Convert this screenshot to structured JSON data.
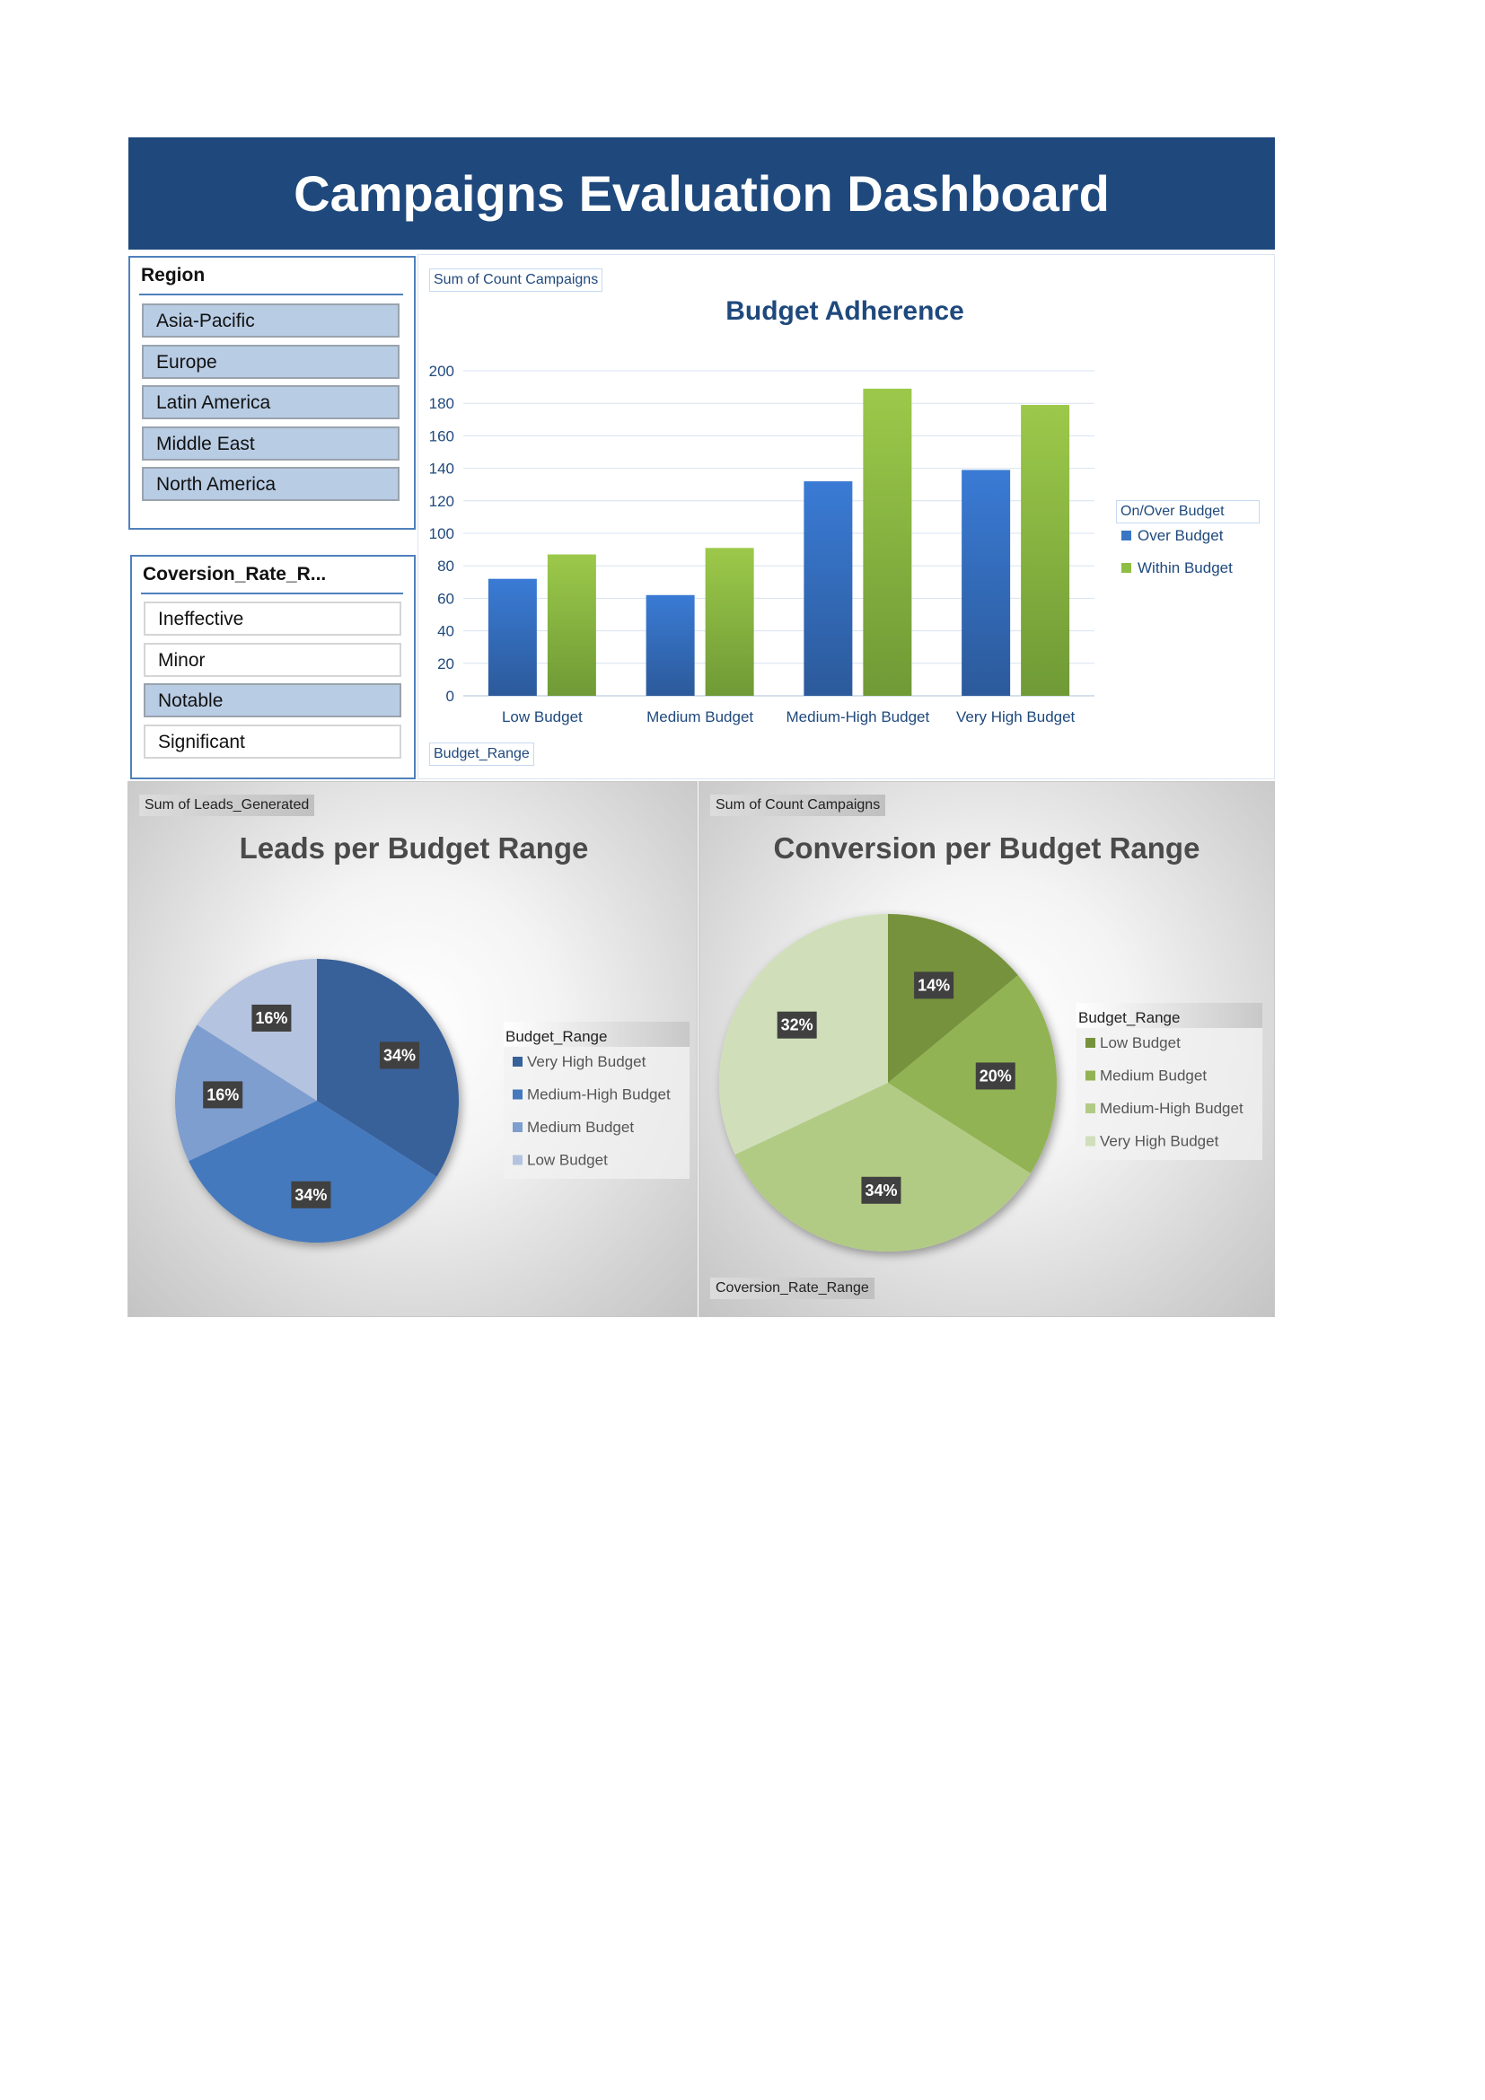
{
  "title": "Campaigns Evaluation Dashboard",
  "region_slicer": {
    "title": "Region",
    "items": [
      {
        "label": "Asia-Pacific",
        "selected": true
      },
      {
        "label": "Europe",
        "selected": true
      },
      {
        "label": "Latin America",
        "selected": true
      },
      {
        "label": "Middle East",
        "selected": true
      },
      {
        "label": "North America",
        "selected": true
      }
    ]
  },
  "conversion_slicer": {
    "title": "Coversion_Rate_R...",
    "items": [
      {
        "label": "Ineffective",
        "selected": false
      },
      {
        "label": "Minor",
        "selected": false
      },
      {
        "label": "Notable",
        "selected": true
      },
      {
        "label": "Significant",
        "selected": false
      }
    ]
  },
  "bar_panel": {
    "value_button": "Sum of Count Campaigns",
    "axis_button": "Budget_Range",
    "legend_button": "On/Over Budget"
  },
  "leads_panel": {
    "value_button": "Sum of Leads_Generated",
    "legend_title": "Budget_Range"
  },
  "conv_panel": {
    "value_button": "Sum of Count Campaigns",
    "filter_button": "Coversion_Rate_Range",
    "legend_title": "Budget_Range"
  },
  "colors": {
    "header": "#1f497d",
    "over_budget": "#3a76c4",
    "within_budget": "#8fbe42",
    "axis_text": "#1f497d"
  },
  "chart_data": [
    {
      "type": "bar",
      "title": "Budget Adherence",
      "categories": [
        "Low Budget",
        "Medium Budget",
        "Medium-High Budget",
        "Very High Budget"
      ],
      "series": [
        {
          "name": "Over Budget",
          "values": [
            72,
            62,
            132,
            139
          ]
        },
        {
          "name": "Within Budget",
          "values": [
            87,
            91,
            189,
            179
          ]
        }
      ],
      "ylim": [
        0,
        200
      ],
      "yticks": [
        0,
        20,
        40,
        60,
        80,
        100,
        120,
        140,
        160,
        180,
        200
      ],
      "grid": true,
      "legend": "right"
    },
    {
      "type": "pie",
      "title": "Leads per Budget Range",
      "labels": [
        "Very High Budget",
        "Medium-High Budget",
        "Medium Budget",
        "Low Budget"
      ],
      "values": [
        34,
        34,
        16,
        16
      ],
      "value_labels": [
        "34%",
        "34%",
        "16%",
        "16%"
      ],
      "colors": [
        "#376199",
        "#4479bd",
        "#7e9ecf",
        "#b4c3e0"
      ],
      "legend": "right"
    },
    {
      "type": "pie",
      "title": "Conversion per Budget Range",
      "labels": [
        "Low Budget",
        "Medium Budget",
        "Medium-High Budget",
        "Very High Budget"
      ],
      "values": [
        14,
        20,
        34,
        32
      ],
      "value_labels": [
        "14%",
        "20%",
        "34%",
        "32%"
      ],
      "colors": [
        "#76923c",
        "#92b352",
        "#b2cb84",
        "#d0dfba"
      ],
      "legend": "right"
    }
  ]
}
